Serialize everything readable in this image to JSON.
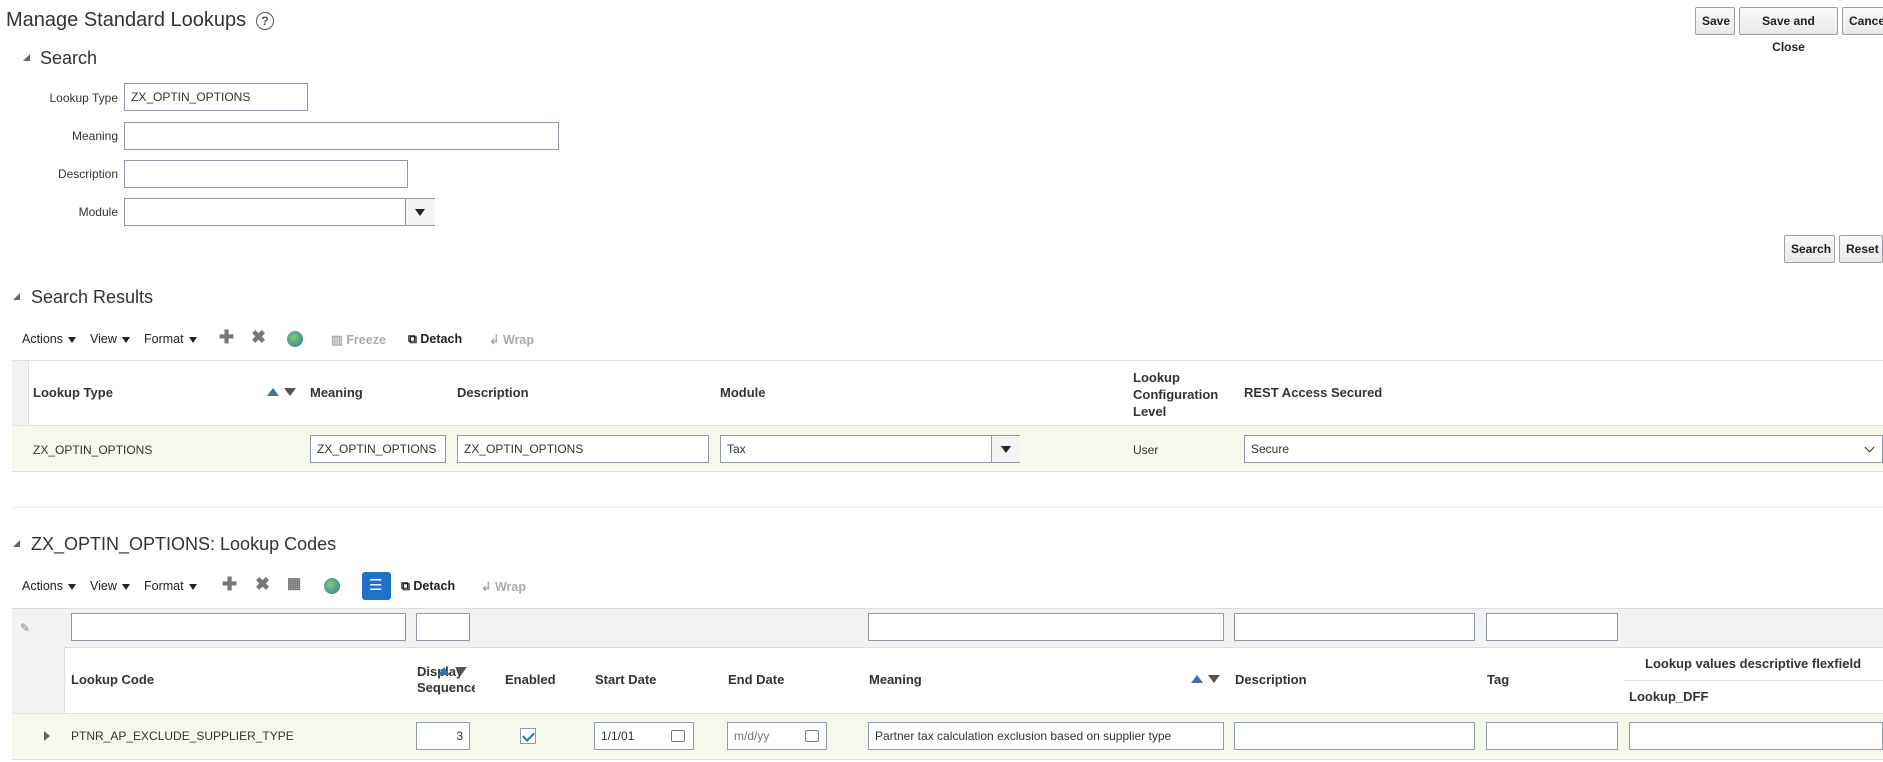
{
  "page": {
    "title": "Manage Standard Lookups",
    "help_icon": "?"
  },
  "top_buttons": {
    "save": "Save",
    "save_close": "Save and Close",
    "cancel": "Cance"
  },
  "search": {
    "title": "Search",
    "fields": {
      "lookup_type": {
        "label": "Lookup Type",
        "value": "ZX_OPTIN_OPTIONS"
      },
      "meaning": {
        "label": "Meaning",
        "value": ""
      },
      "description": {
        "label": "Description",
        "value": ""
      },
      "module": {
        "label": "Module",
        "value": ""
      }
    },
    "search_button": "Search",
    "reset_button": "Reset"
  },
  "results": {
    "title": "Search Results",
    "toolbar": {
      "actions": "Actions",
      "view": "View",
      "format": "Format",
      "freeze": "Freeze",
      "detach": "Detach",
      "wrap": "Wrap"
    },
    "columns": {
      "lookup_type": "Lookup Type",
      "meaning": "Meaning",
      "description": "Description",
      "module": "Module",
      "config_level_1": "Lookup",
      "config_level_2": "Configuration",
      "config_level_3": "Level",
      "rest": "REST Access Secured"
    },
    "row": {
      "lookup_type": "ZX_OPTIN_OPTIONS",
      "meaning": "ZX_OPTIN_OPTIONS",
      "description": "ZX_OPTIN_OPTIONS",
      "module": "Tax",
      "config_level": "User",
      "rest": "Secure"
    }
  },
  "codes": {
    "title": "ZX_OPTIN_OPTIONS: Lookup Codes",
    "toolbar": {
      "actions": "Actions",
      "view": "View",
      "format": "Format",
      "detach": "Detach",
      "wrap": "Wrap"
    },
    "columns": {
      "lookup_code": "Lookup Code",
      "display_seq_1": "Display",
      "display_seq_2": "Sequence",
      "enabled": "Enabled",
      "start_date": "Start Date",
      "end_date": "End Date",
      "meaning": "Meaning",
      "description": "Description",
      "tag": "Tag",
      "dff_group": "Lookup values descriptive flexfield",
      "dff": "Lookup_DFF"
    },
    "row": {
      "lookup_code": "PTNR_AP_EXCLUDE_SUPPLIER_TYPE",
      "display_seq": "3",
      "enabled": true,
      "start_date": "1/1/01",
      "end_date_placeholder": "m/d/yy",
      "meaning": "Partner tax calculation exclusion based on supplier type",
      "description": "",
      "tag": "",
      "dff": ""
    }
  }
}
